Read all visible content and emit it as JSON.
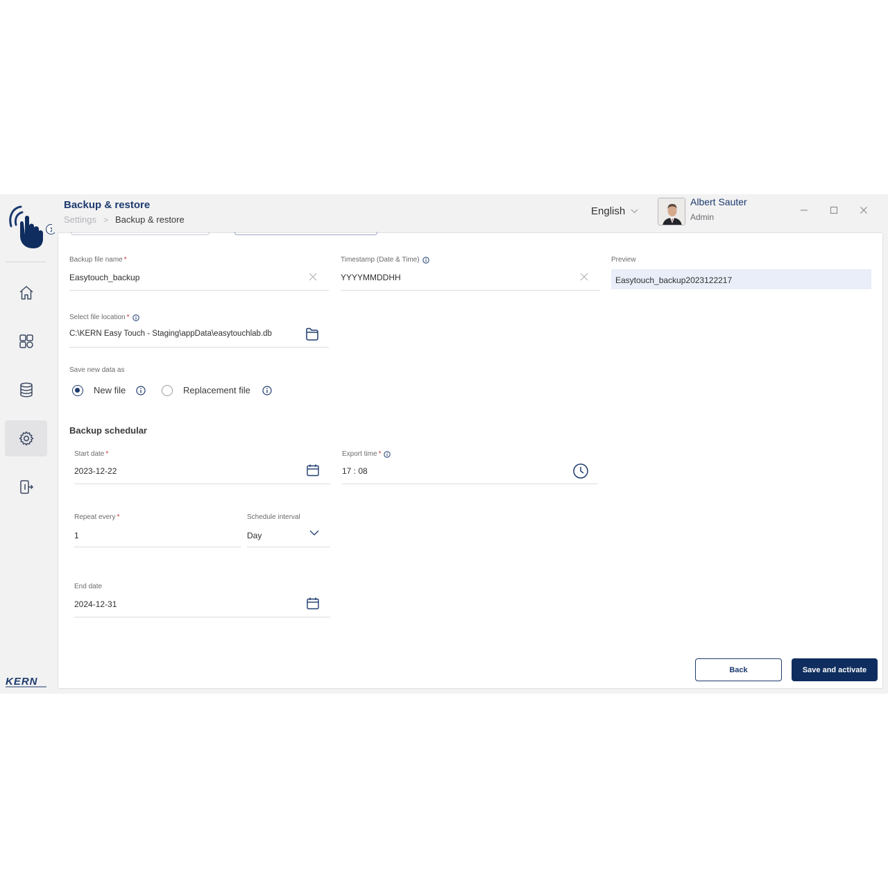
{
  "header": {
    "title": "Backup & restore",
    "breadcrumb": {
      "root": "Settings",
      "separator": ">",
      "current": "Backup & restore"
    },
    "language": "English",
    "user": {
      "name": "Albert Sauter",
      "role": "Admin"
    }
  },
  "sidebar": {
    "items": [
      {
        "name": "home",
        "icon": "home-icon"
      },
      {
        "name": "apps",
        "icon": "grid-icon"
      },
      {
        "name": "database",
        "icon": "database-icon"
      },
      {
        "name": "settings",
        "icon": "gear-icon",
        "active": true
      },
      {
        "name": "logout",
        "icon": "logout-icon"
      }
    ],
    "brand": "KERN"
  },
  "form": {
    "backup_file_name": {
      "label": "Backup file name",
      "required": "*",
      "value": "Easytouch_backup"
    },
    "timestamp": {
      "label": "Timestamp (Date & Time)",
      "value": "YYYYMMDDHH"
    },
    "preview": {
      "label": "Preview",
      "value": "Easytouch_backup2023122217"
    },
    "file_location": {
      "label": "Select file location",
      "required": "*",
      "value": "C:\\KERN Easy Touch - Staging\\appData\\easytouchlab.db"
    },
    "save_as": {
      "label": "Save new data as",
      "options": [
        "New file",
        "Replacement file"
      ],
      "selected": "New file"
    },
    "schedular": {
      "title": "Backup schedular",
      "start_date": {
        "label": "Start date",
        "required": "*",
        "value": "2023-12-22"
      },
      "export_time": {
        "label": "Export time",
        "required": "*",
        "value": "17 : 08"
      },
      "repeat_every": {
        "label": "Repeat every",
        "required": "*",
        "value": "1"
      },
      "schedule_interval": {
        "label": "Schedule interval",
        "value": "Day"
      },
      "end_date": {
        "label": "End date",
        "value": "2024-12-31"
      }
    }
  },
  "actions": {
    "back": "Back",
    "save": "Save and activate"
  },
  "colors": {
    "primary": "#0f2d5e",
    "accent": "#1d3a6e",
    "required": "#c6323a",
    "preview_bg": "#e9eef8"
  }
}
